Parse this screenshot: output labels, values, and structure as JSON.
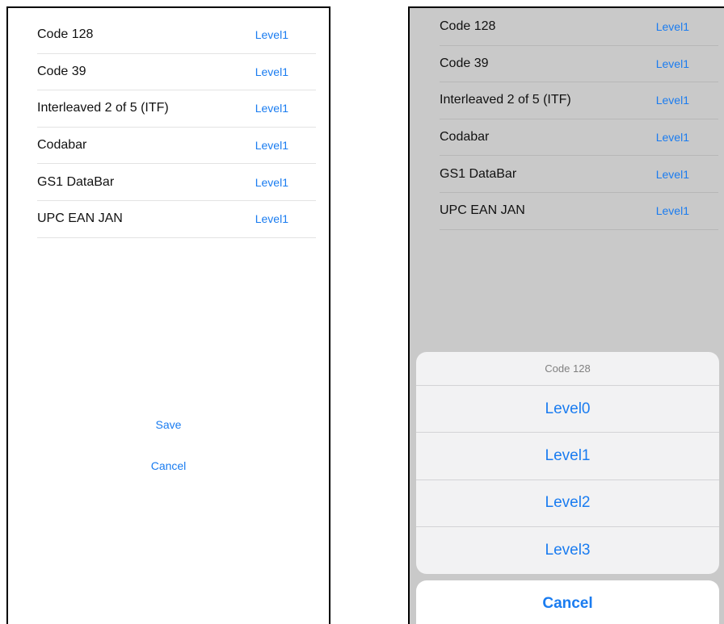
{
  "left_screen": {
    "rows": [
      {
        "label": "Code 128",
        "value": "Level1"
      },
      {
        "label": "Code 39",
        "value": "Level1"
      },
      {
        "label": "Interleaved 2 of 5 (ITF)",
        "value": "Level1"
      },
      {
        "label": "Codabar",
        "value": "Level1"
      },
      {
        "label": "GS1 DataBar",
        "value": "Level1"
      },
      {
        "label": "UPC EAN JAN",
        "value": "Level1"
      }
    ],
    "save_label": "Save",
    "cancel_label": "Cancel"
  },
  "right_screen": {
    "rows": [
      {
        "label": "Code 128",
        "value": "Level1"
      },
      {
        "label": "Code 39",
        "value": "Level1"
      },
      {
        "label": "Interleaved 2 of 5 (ITF)",
        "value": "Level1"
      },
      {
        "label": "Codabar",
        "value": "Level1"
      },
      {
        "label": "GS1 DataBar",
        "value": "Level1"
      },
      {
        "label": "UPC EAN JAN",
        "value": "Level1"
      }
    ],
    "action_sheet": {
      "title": "Code 128",
      "options": [
        "Level0",
        "Level1",
        "Level2",
        "Level3"
      ],
      "cancel_label": "Cancel"
    }
  },
  "colors": {
    "accent": "#1a7cf0",
    "dim_overlay": "#c9c9c9",
    "sheet_background": "#f2f2f3"
  }
}
